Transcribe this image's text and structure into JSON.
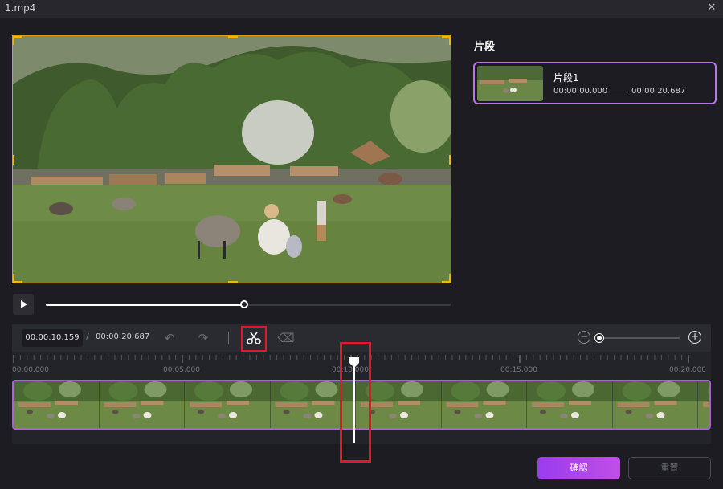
{
  "window": {
    "title": "1.mp4",
    "close_glyph": "✕"
  },
  "player": {
    "progress_fraction": 0.49,
    "play_icon": "play-icon"
  },
  "segments_panel": {
    "heading": "片段",
    "items": [
      {
        "name": "片段1",
        "start": "00:00:00.000",
        "end": "00:00:20.687"
      }
    ]
  },
  "toolbar": {
    "current_time": "00:00:10.159",
    "separator": "/",
    "total_time": "00:00:20.687",
    "icons": [
      "undo-icon",
      "redo-icon",
      "scissors-icon",
      "eraser-icon",
      "zoom-out-icon",
      "zoom-in-icon"
    ],
    "undo_glyph": "↶",
    "redo_glyph": "↷",
    "eraser_glyph": "⌫",
    "zoom_out_glyph": "−",
    "zoom_in_glyph": "+",
    "zoom_fraction": 0.0
  },
  "ruler": {
    "ticks": [
      "00:00.000",
      "00:05.000",
      "00:10.000",
      "00:15.000",
      "00:20.000"
    ]
  },
  "timeline": {
    "playhead_fraction": 0.49
  },
  "colors": {
    "accent": "#a95fe0",
    "highlight_red": "#e0182a",
    "crop_yellow": "#f2b705"
  },
  "footer": {
    "confirm_label": "確認",
    "reset_label": "重置"
  }
}
